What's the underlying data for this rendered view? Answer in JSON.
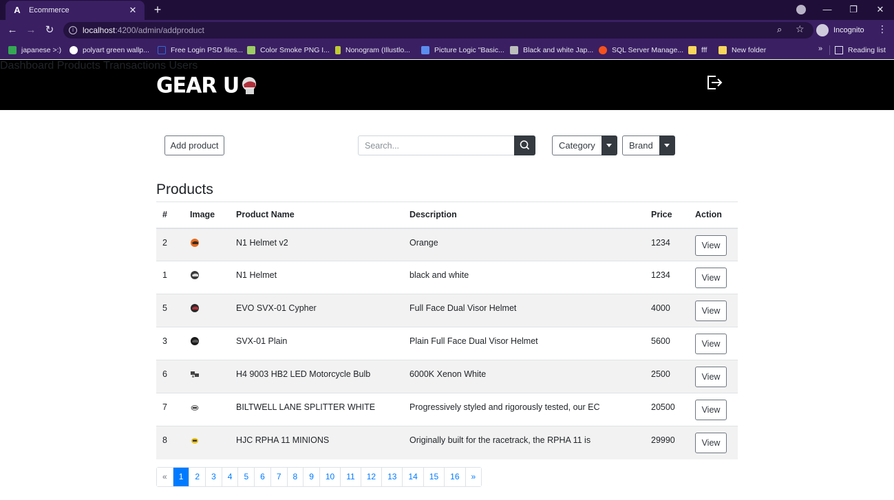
{
  "browser": {
    "tab_title": "Ecommerce",
    "url_host": "localhost",
    "url_path": ":4200/admin/addproduct",
    "profile_label": "Incognito",
    "bookmarks": [
      {
        "label": "japanese >:)",
        "color": "#34a853"
      },
      {
        "label": "polyart green wallp...",
        "color": "#ffffff"
      },
      {
        "label": "Free Login PSD files...",
        "color": "#2f6bd8"
      },
      {
        "label": "Color Smoke PNG I...",
        "color": "#9ccc65"
      },
      {
        "label": "Nonogram (Illustlo...",
        "color": "#c0ca33"
      },
      {
        "label": "Picture Logic \"Basic...",
        "color": "#5b8def"
      },
      {
        "label": "Black and white Jap...",
        "color": "#bdbdbd"
      },
      {
        "label": "SQL Server Manage...",
        "color": "#f4511e"
      },
      {
        "label": "fff",
        "color": "#f9d65c"
      },
      {
        "label": "New folder",
        "color": "#f9d65c"
      }
    ],
    "bookmarks_more": "»",
    "reading_list": "Reading list"
  },
  "header": {
    "logo_text": "GEAR U",
    "nav": [
      "Dashboard",
      "Products",
      "Transactions",
      "Users"
    ]
  },
  "controls": {
    "add_product": "Add product",
    "search_placeholder": "Search...",
    "category": "Category",
    "brand": "Brand"
  },
  "products": {
    "title": "Products",
    "columns": [
      "#",
      "Image",
      "Product Name",
      "Description",
      "Price",
      "Action"
    ],
    "rows": [
      {
        "id": "2",
        "name": "N1 Helmet v2",
        "description": "Orange",
        "price": "1234",
        "action": "View",
        "thumb": "#e86a1c"
      },
      {
        "id": "1",
        "name": "N1 Helmet",
        "description": "black and white",
        "price": "1234",
        "action": "View",
        "thumb": "#3a3a3a"
      },
      {
        "id": "5",
        "name": "EVO SVX-01 Cypher",
        "description": "Full Face Dual Visor Helmet",
        "price": "4000",
        "action": "View",
        "thumb": "#8a2a1e"
      },
      {
        "id": "3",
        "name": "SVX-01 Plain",
        "description": "Plain Full Face Dual Visor Helmet",
        "price": "5600",
        "action": "View",
        "thumb": "#1b1b1b"
      },
      {
        "id": "6",
        "name": "H4 9003 HB2 LED Motorcycle Bulb",
        "description": "6000K Xenon White",
        "price": "2500",
        "action": "View",
        "thumb": "#444444"
      },
      {
        "id": "7",
        "name": "BILTWELL LANE SPLITTER WHITE",
        "description": "Progressively styled and rigorously tested, our EC",
        "price": "20500",
        "action": "View",
        "thumb": "#cfcfcf"
      },
      {
        "id": "8",
        "name": "HJC RPHA 11 MINIONS",
        "description": "Originally built for the racetrack, the RPHA 11 is",
        "price": "29990",
        "action": "View",
        "thumb": "#e8c21a"
      }
    ]
  },
  "pagination": {
    "prev": "«",
    "pages": [
      "1",
      "2",
      "3",
      "4",
      "5",
      "6",
      "7",
      "8",
      "9",
      "10",
      "11",
      "12",
      "13",
      "14",
      "15",
      "16"
    ],
    "active": "1",
    "next": "»"
  }
}
